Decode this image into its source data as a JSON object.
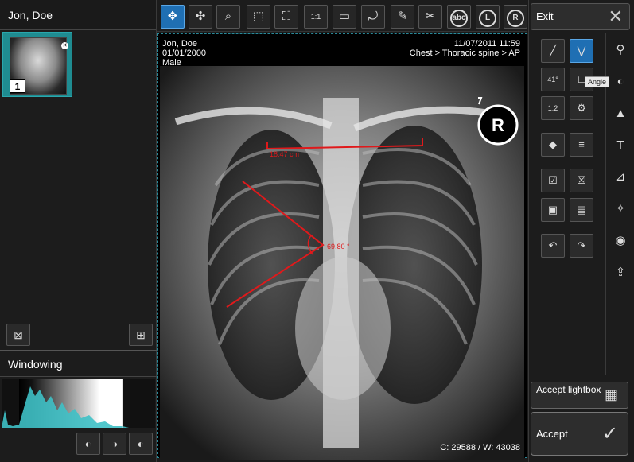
{
  "left_panel": {
    "patient_name": "Jon, Doe",
    "thumbnail_number": "1",
    "windowing_title": "Windowing"
  },
  "overlay": {
    "patient_name": "Jon, Doe",
    "dob": "01/01/2000",
    "sex": "Male",
    "datetime": "11/07/2011 11:59",
    "study": "Chest > Thoracic spine > AP",
    "window_info": "C: 29588 / W: 43038",
    "measure_length": "18.47 cm",
    "measure_angle": "69.80 °",
    "marker": "R"
  },
  "toolbar": {
    "abc": "abc",
    "l": "L",
    "r": "R",
    "scale": "1:1"
  },
  "right_panel": {
    "exit_label": "Exit",
    "tooltip": "Angle",
    "ratio_label": "1:2",
    "angle_label": "41°",
    "accept_lightbox": "Accept lightbox",
    "accept": "Accept"
  },
  "colors": {
    "accent": "#1f6fb3",
    "teal": "#1f8c91",
    "measure": "#e0191b"
  }
}
